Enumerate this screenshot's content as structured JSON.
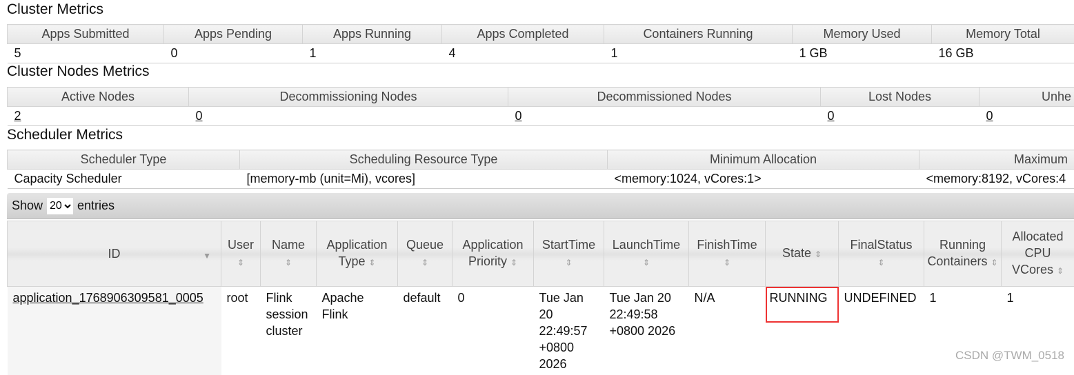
{
  "cluster_metrics": {
    "title": "Cluster Metrics",
    "headers": [
      "Apps Submitted",
      "Apps Pending",
      "Apps Running",
      "Apps Completed",
      "Containers Running",
      "Memory Used",
      "Memory Total"
    ],
    "values": [
      "5",
      "0",
      "1",
      "4",
      "1",
      "1 GB",
      "16 GB"
    ]
  },
  "nodes_metrics": {
    "title": "Cluster Nodes Metrics",
    "headers": [
      "Active Nodes",
      "Decommissioning Nodes",
      "Decommissioned Nodes",
      "Lost Nodes",
      "Unhe"
    ],
    "values": [
      "2",
      "0",
      "0",
      "0",
      "0"
    ]
  },
  "scheduler_metrics": {
    "title": "Scheduler Metrics",
    "headers": [
      "Scheduler Type",
      "Scheduling Resource Type",
      "Minimum Allocation",
      "Maximum"
    ],
    "values": [
      "Capacity Scheduler",
      "[memory-mb (unit=Mi), vcores]",
      "<memory:1024, vCores:1>",
      "<memory:8192, vCores:4"
    ]
  },
  "entries": {
    "show": "Show",
    "value": "20",
    "suffix": "entries"
  },
  "apps": {
    "headers": [
      "ID",
      "User",
      "Name",
      "Application Type",
      "Queue",
      "Application Priority",
      "StartTime",
      "LaunchTime",
      "FinishTime",
      "State",
      "FinalStatus",
      "Running Containers",
      "Allocated CPU VCores"
    ],
    "rows": [
      [
        "application_1768906309581_0005",
        "root",
        "Flink session cluster",
        "Apache Flink",
        "default",
        "0",
        "Tue Jan 20 22:49:57 +0800 2026",
        "Tue Jan 20 22:49:58 +0800 2026",
        "N/A",
        "RUNNING",
        "UNDEFINED",
        "1",
        "1"
      ]
    ]
  },
  "highlight_color": "#e83a3a",
  "watermark": "CSDN @TWM_0518"
}
